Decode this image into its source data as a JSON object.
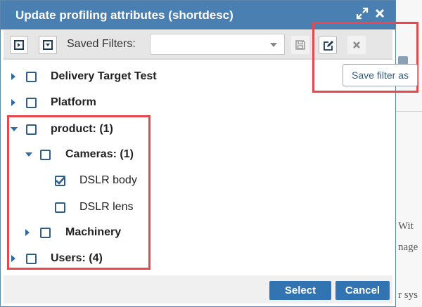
{
  "dialog": {
    "title": "Update profiling attributes (shortdesc)"
  },
  "toolbar": {
    "saved_filters_label": "Saved Filters:",
    "saved_filter_value": ""
  },
  "tooltip": {
    "text": "Save filter as"
  },
  "tree": [
    {
      "label": "Delivery Target Test",
      "bold": true,
      "checked": false,
      "expander": "collapsed"
    },
    {
      "label": "Platform",
      "bold": true,
      "checked": false,
      "expander": "collapsed"
    },
    {
      "label": "product: (1)",
      "bold": true,
      "checked": false,
      "expander": "expanded"
    },
    {
      "label": "Cameras: (1)",
      "bold": true,
      "checked": false,
      "expander": "expanded"
    },
    {
      "label": "DSLR body",
      "bold": false,
      "checked": true,
      "expander": "none"
    },
    {
      "label": "DSLR lens",
      "bold": false,
      "checked": false,
      "expander": "none"
    },
    {
      "label": "Machinery",
      "bold": true,
      "checked": false,
      "expander": "collapsed"
    },
    {
      "label": "Users: (4)",
      "bold": true,
      "checked": false,
      "expander": "collapsed"
    }
  ],
  "footer": {
    "select_label": "Select",
    "cancel_label": "Cancel"
  },
  "background": {
    "text_1": "Wit",
    "text_2": "nage",
    "text_3": "r sys"
  },
  "colors": {
    "titlebar": "#4a7fb1",
    "primary_button": "#3273b2",
    "highlight": "#e8484d",
    "expander": "#2e6aa3"
  },
  "icons": {
    "expand_all": "play-square-icon",
    "collapse_all": "caret-down-square-icon",
    "save": "floppy-disk-icon",
    "save_as": "edit-icon",
    "clear": "close-icon",
    "maximize": "expand-arrows-icon",
    "close": "close-icon"
  }
}
